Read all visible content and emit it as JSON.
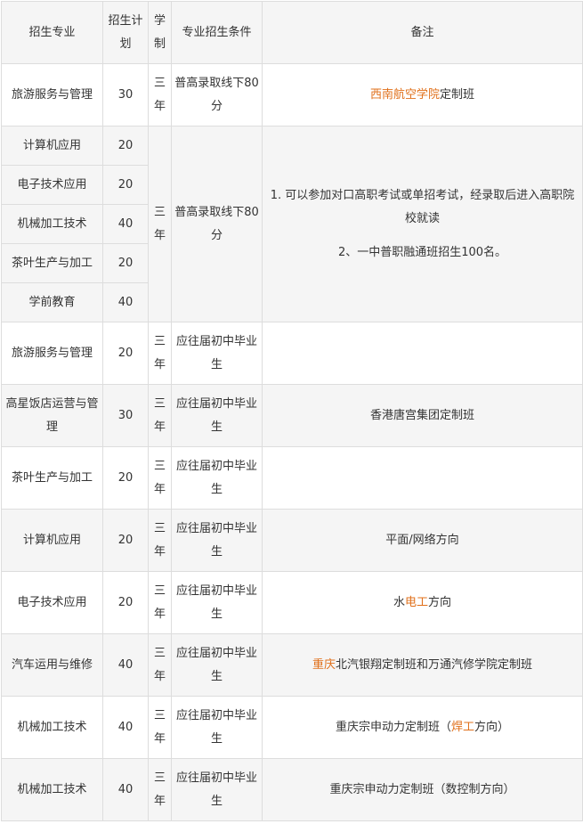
{
  "header": {
    "major": "招生专业",
    "plan": "招生计划",
    "duration": "学制",
    "condition": "专业招生条件",
    "notes": "备注"
  },
  "colors": {
    "highlight": "#e0701b",
    "shade": "#f5f5f5",
    "border": "#dddddd"
  },
  "rows": [
    {
      "major": "旅游服务与管理",
      "plan": "30",
      "duration": "三年",
      "condition": "普高录取线下80分",
      "note_hl1": "西南航空学院",
      "note_rest": "定制班"
    },
    {
      "major": "计算机应用",
      "plan": "20"
    },
    {
      "major": "电子技术应用",
      "plan": "20"
    },
    {
      "major": "机械加工技术",
      "plan": "40"
    },
    {
      "major": "茶叶生产与加工",
      "plan": "20"
    },
    {
      "major": "学前教育",
      "plan": "40"
    },
    {
      "major": "旅游服务与管理",
      "plan": "20",
      "duration": "三年",
      "condition": "应往届初中毕业生",
      "note": ""
    },
    {
      "major": "高星饭店运营与管理",
      "plan": "30",
      "duration": "三年",
      "condition": "应往届初中毕业生",
      "note": "香港唐宫集团定制班"
    },
    {
      "major": "茶叶生产与加工",
      "plan": "20",
      "duration": "三年",
      "condition": "应往届初中毕业生",
      "note": ""
    },
    {
      "major": "计算机应用",
      "plan": "20",
      "duration": "三年",
      "condition": "应往届初中毕业生",
      "note": "平面/网络方向"
    },
    {
      "major": "电子技术应用",
      "plan": "20",
      "duration": "三年",
      "condition": "应往届初中毕业生",
      "note_a": "水",
      "note_hl": "电工",
      "note_b": "方向"
    },
    {
      "major": "汽车运用与维修",
      "plan": "40",
      "duration": "三年",
      "condition": "应往届初中毕业生",
      "note_hl": "重庆",
      "note_b": "北汽银翔定制班和万通汽修学院定制班"
    },
    {
      "major": "机械加工技术",
      "plan": "40",
      "duration": "三年",
      "condition": "应往届初中毕业生",
      "note_a": "重庆宗申动力定制班（",
      "note_hl": "焊工",
      "note_b": "方向）"
    },
    {
      "major": "机械加工技术",
      "plan": "40",
      "duration": "三年",
      "condition": "应往届初中毕业生",
      "note": "重庆宗申动力定制班（数控制方向）"
    }
  ],
  "merged_group": {
    "duration": "三年",
    "condition": "普高录取线下80分",
    "note_line1": "1. 可以参加对口高职考试或单招考试，经录取后进入高职院校就读",
    "note_line2": "2、一中普职融通班招生100名。"
  }
}
